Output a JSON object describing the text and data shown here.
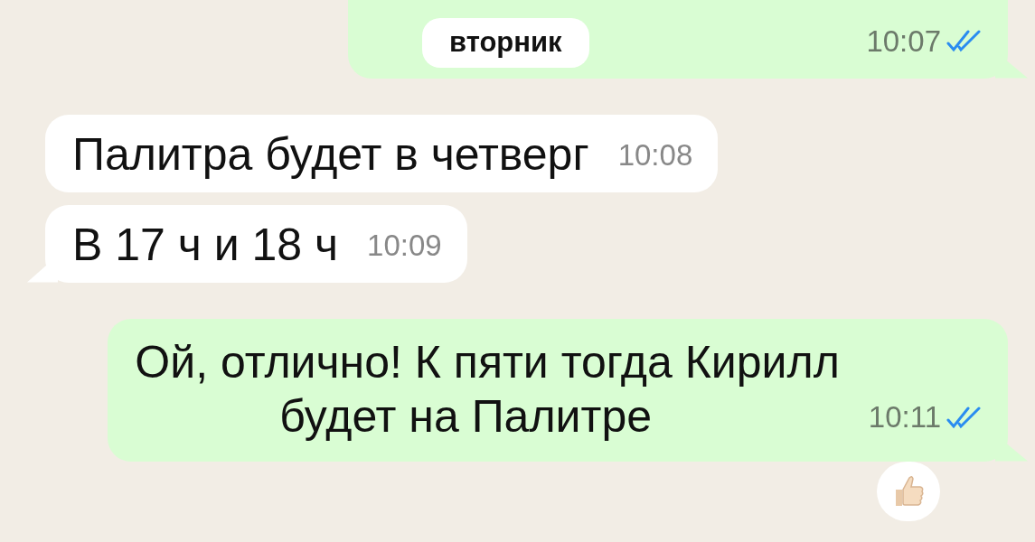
{
  "messages": [
    {
      "kind": "outgoing",
      "cut_top": true,
      "date_chip": "вторник",
      "time": "10:07",
      "read": true,
      "tail": true
    },
    {
      "kind": "incoming",
      "lines": [
        "Палитра будет в четверг"
      ],
      "time": "10:08",
      "tail": false
    },
    {
      "kind": "incoming",
      "lines": [
        "В 17 ч и 18 ч"
      ],
      "time": "10:09",
      "tail": true
    },
    {
      "kind": "outgoing",
      "lines": [
        "Ой, отлично! К пяти тогда Кирилл",
        "будет на Палитре"
      ],
      "redacted_gap": true,
      "time": "10:11",
      "read": true,
      "tail": true,
      "reacted": true
    }
  ]
}
